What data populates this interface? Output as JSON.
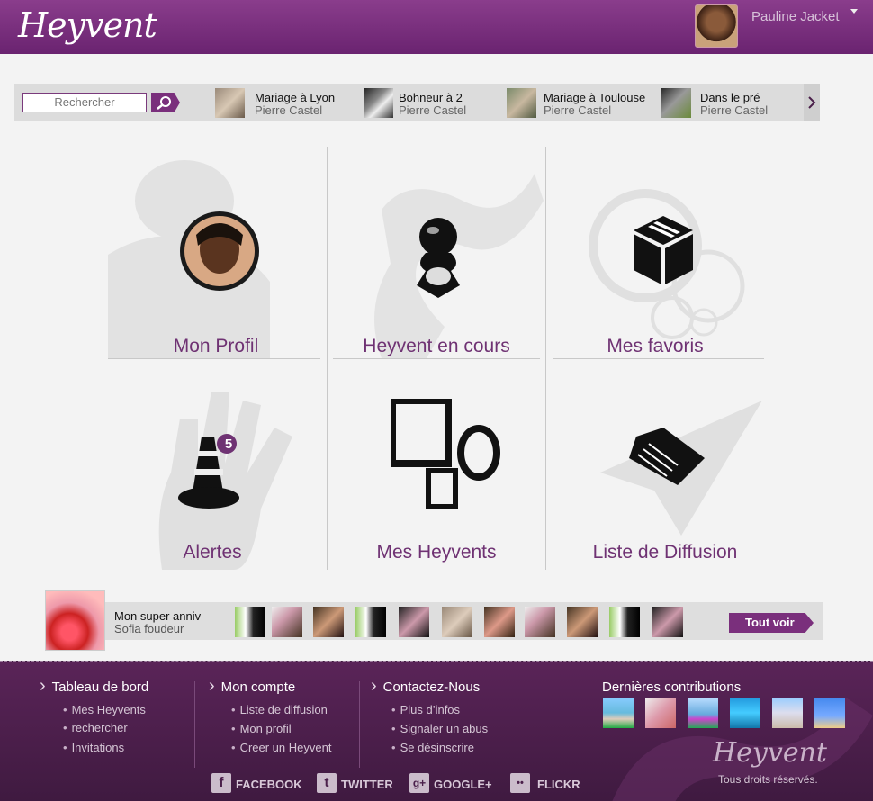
{
  "header": {
    "logo": "Heyvent",
    "username": "Pauline Jacket"
  },
  "search": {
    "placeholder": "Rechercher"
  },
  "strip_items": [
    {
      "title": "Mariage à Lyon",
      "author": "Pierre Castel"
    },
    {
      "title": "Bohneur à 2",
      "author": "Pierre Castel"
    },
    {
      "title": "Mariage à Toulouse",
      "author": "Pierre Castel"
    },
    {
      "title": "Dans le pré",
      "author": "Pierre Castel"
    }
  ],
  "tiles": {
    "profile": "Mon Profil",
    "current": "Heyvent en cours",
    "favorites": "Mes favoris",
    "alerts": "Alertes",
    "alerts_badge": "5",
    "my_heyvents": "Mes Heyvents",
    "mailing": "Liste de Diffusion"
  },
  "event_strip": {
    "title": "Mon super anniv",
    "author": "Sofia foudeur",
    "see_all": "Tout voir"
  },
  "footer": {
    "col1": {
      "title": "Tableau de bord",
      "links": [
        "Mes Heyvents",
        "rechercher",
        "Invitations"
      ]
    },
    "col2": {
      "title": "Mon compte",
      "links": [
        "Liste de diffusion",
        "Mon profil",
        "Creer un Heyvent"
      ]
    },
    "col3": {
      "title": "Contactez-Nous",
      "links": [
        "Plus d’infos",
        "Signaler un abus",
        "Se désinscrire"
      ]
    },
    "contrib_title": "Dernières contributions",
    "social": [
      "FACEBOOK",
      "TWITTER",
      "GOOGLE+",
      "FLICKR"
    ],
    "social_icons": [
      "f",
      "t",
      "g+",
      "••"
    ],
    "logo": "Heyvent",
    "rights": "Tous droits réservés."
  },
  "colors": {
    "brand": "#7a2f7c",
    "label": "#6f3273"
  }
}
